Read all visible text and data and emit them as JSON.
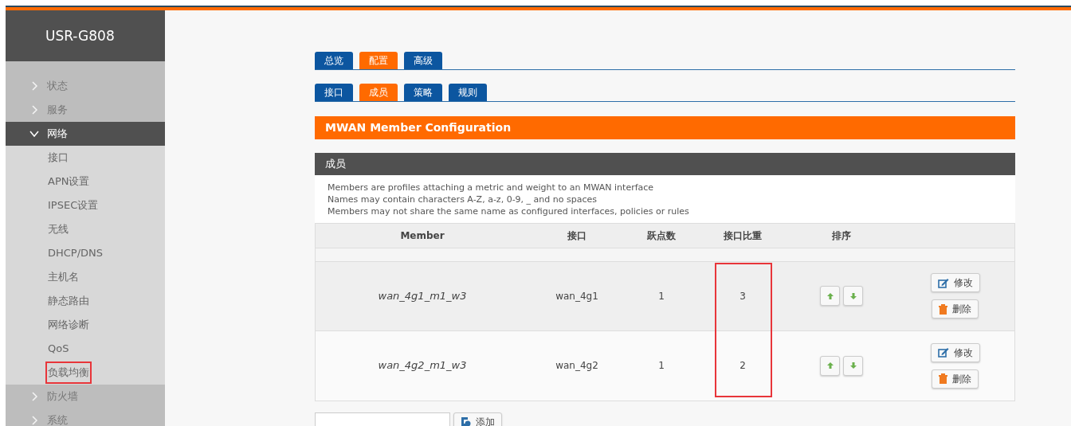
{
  "brand": "USR-G808",
  "sidebar": {
    "items": [
      {
        "label": "状态",
        "expanded": false
      },
      {
        "label": "服务",
        "expanded": false
      },
      {
        "label": "网络",
        "expanded": true,
        "children": [
          {
            "label": "接口",
            "highlighted": false
          },
          {
            "label": "APN设置",
            "highlighted": false
          },
          {
            "label": "IPSEC设置",
            "highlighted": false
          },
          {
            "label": "无线",
            "highlighted": false
          },
          {
            "label": "DHCP/DNS",
            "highlighted": false
          },
          {
            "label": "主机名",
            "highlighted": false
          },
          {
            "label": "静态路由",
            "highlighted": false
          },
          {
            "label": "网络诊断",
            "highlighted": false
          },
          {
            "label": "QoS",
            "highlighted": false
          },
          {
            "label": "负载均衡",
            "highlighted": true
          }
        ]
      },
      {
        "label": "防火墙",
        "expanded": false
      },
      {
        "label": "系统",
        "expanded": false
      }
    ]
  },
  "tabs": [
    {
      "label": "总览",
      "selected": false
    },
    {
      "label": "配置",
      "selected": true
    },
    {
      "label": "高级",
      "selected": false
    }
  ],
  "subtabs": [
    {
      "label": "接口",
      "selected": false
    },
    {
      "label": "成员",
      "selected": true
    },
    {
      "label": "策略",
      "selected": false
    },
    {
      "label": "规则",
      "selected": false
    }
  ],
  "page_title": "MWAN Member Configuration",
  "section": {
    "title": "成员",
    "description": [
      "Members are profiles attaching a metric and weight to an MWAN interface",
      "Names may contain characters A-Z, a-z, 0-9, _ and no spaces",
      "Members may not share the same name as configured interfaces, policies or rules"
    ]
  },
  "table": {
    "columns": [
      {
        "label": "Member",
        "highlighted": false
      },
      {
        "label": "接口",
        "highlighted": false
      },
      {
        "label": "跃点数",
        "highlighted": false
      },
      {
        "label": "接口比重",
        "highlighted": true
      },
      {
        "label": "排序",
        "highlighted": false
      }
    ],
    "rows": [
      {
        "member": "wan_4g1_m1_w3",
        "interface": "wan_4g1",
        "metric": "1",
        "weight": "3",
        "edit": "修改",
        "delete": "删除"
      },
      {
        "member": "wan_4g2_m1_w3",
        "interface": "wan_4g2",
        "metric": "1",
        "weight": "2",
        "edit": "修改",
        "delete": "删除"
      }
    ]
  },
  "add": {
    "button": "添加"
  }
}
